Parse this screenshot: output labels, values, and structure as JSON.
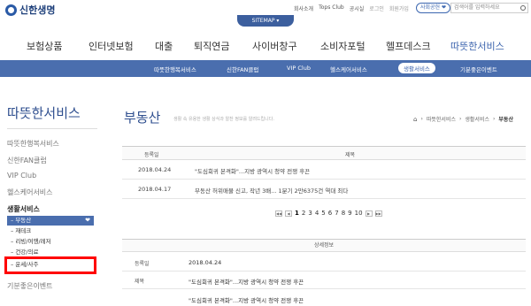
{
  "logo": {
    "text": "신한생명"
  },
  "util": {
    "items": [
      "회사소개",
      "Tops Club",
      "공시실",
      "로그인",
      "회원가입"
    ],
    "social": "사회공헌 ❤",
    "search_placeholder": "검색어를 입력하세요"
  },
  "sitemap": "SITEMAP ▾",
  "gnb": [
    "보험상품",
    "인터넷보험",
    "대출",
    "퇴직연금",
    "사이버창구",
    "소비자포털",
    "헬프데스크",
    "따뜻한서비스"
  ],
  "subnav": [
    "따뜻한행복서비스",
    "신한FAN클럽",
    "VIP Club",
    "헬스케어서비스",
    "생활서비스",
    "기분좋은이벤트"
  ],
  "sidebar": {
    "title": "따뜻한서비스",
    "items": [
      "따뜻한행복서비스",
      "신한FAN클럽",
      "VIP Club",
      "헬스케어서비스",
      "생활서비스"
    ],
    "subs": [
      "부동산",
      "재테크",
      "리빙/여행/레저",
      "건강/의료",
      "운세/사주"
    ],
    "last": "기분좋은이벤트"
  },
  "content": {
    "title": "부동산",
    "desc": "생활 속 유용한 생활 상식과 알찬 정보를 알려드립니다.",
    "breadcrumb": [
      "따뜻한서비스",
      "생활서비스",
      "부동산"
    ]
  },
  "table": {
    "headers": [
      "등록일",
      "제목"
    ],
    "rows": [
      {
        "date": "2018.04.24",
        "title": "\"도심회귀 본격화\"...지방 광역시 청약 전쟁 후끈"
      },
      {
        "date": "2018.04.17",
        "title": "부동산 허위매물 신고, 작년 3배... 1분기 2만6375건 역대 최다"
      }
    ]
  },
  "pager": {
    "first": "◀◀",
    "prev": "◀",
    "pages": [
      "1",
      "2",
      "3",
      "4",
      "5",
      "6",
      "7",
      "8",
      "9",
      "10"
    ],
    "next": "▶",
    "last": "▶▶"
  },
  "detail": {
    "header": "상세정보",
    "date_label": "등록일",
    "date": "2018.04.24",
    "title_label": "제목",
    "title": "\"도심회귀 본격화\"...지방 광역시 청약 전쟁 후끈",
    "body": "\"도심회귀 본격화\"...지방 광역시 청약 전쟁 후끈"
  }
}
